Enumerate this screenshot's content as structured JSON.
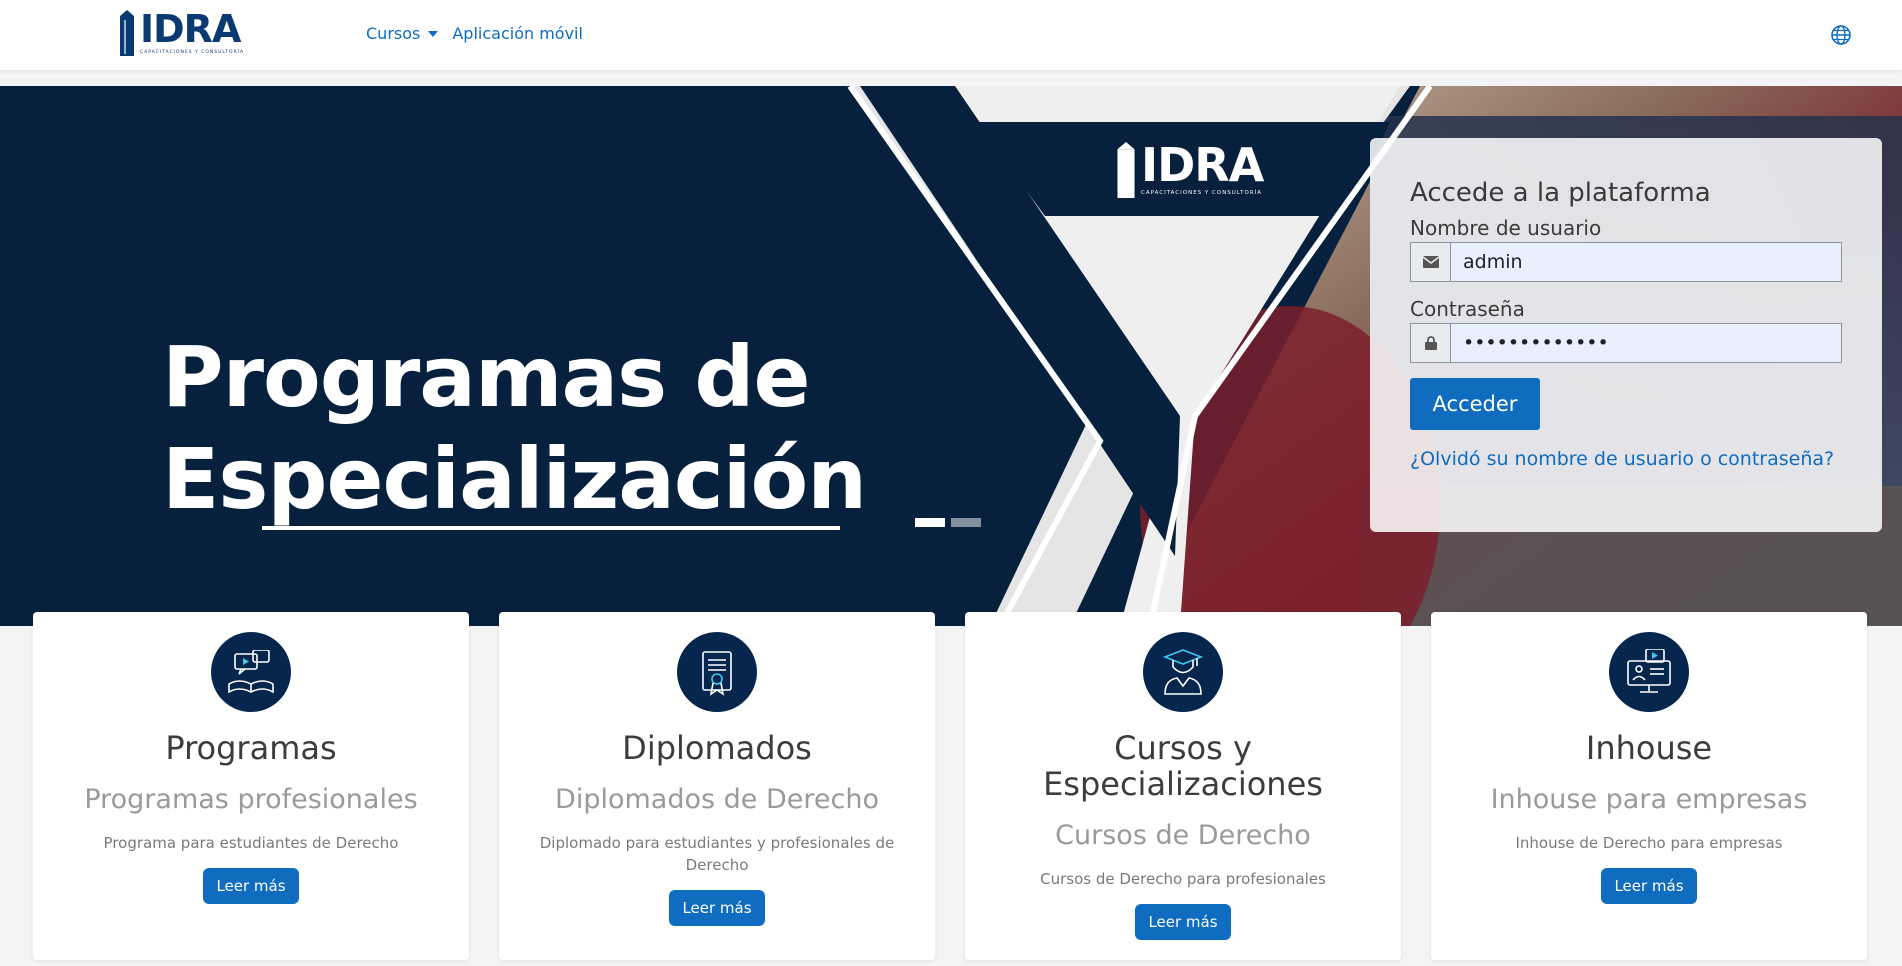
{
  "brand": {
    "name": "IDRA",
    "tagline": "CAPACITACIONES Y CONSULTORÍA",
    "color": "#0b3a73"
  },
  "nav": {
    "items": [
      {
        "label": "Cursos",
        "dropdown": true
      },
      {
        "label": "Aplicación móvil",
        "dropdown": false
      }
    ],
    "language_icon": "globe-icon",
    "link_color": "#0f6cbf"
  },
  "hero": {
    "title_line1": "Programas de",
    "title_line2": "Especialización",
    "slides": 2,
    "active_slide": 1,
    "background": "#06203d"
  },
  "login": {
    "title": "Accede a la plataforma",
    "username_label": "Nombre de usuario",
    "username_value": "admin",
    "username_icon": "envelope-icon",
    "password_label": "Contraseña",
    "password_value": "•••••••••••••",
    "password_icon": "lock-icon",
    "submit_label": "Acceder",
    "forgot_label": "¿Olvidó su nombre de usuario o contraseña?"
  },
  "cards": [
    {
      "icon": "video-book-icon",
      "title": "Programas",
      "subtitle": "Programas profesionales",
      "description": "Programa para estudiantes de Derecho",
      "button": "Leer más"
    },
    {
      "icon": "certificate-icon",
      "title": "Diplomados",
      "subtitle": "Diplomados de Derecho",
      "description": "Diplomado para estudiantes y profesionales de Derecho",
      "button": "Leer más"
    },
    {
      "icon": "graduate-icon",
      "title": "Cursos y Especializaciones",
      "subtitle": "Cursos de Derecho",
      "description": "Cursos de Derecho para profesionales",
      "button": "Leer más"
    },
    {
      "icon": "online-class-icon",
      "title": "Inhouse",
      "subtitle": "Inhouse para empresas",
      "description": "Inhouse de Derecho para empresas",
      "button": "Leer más"
    }
  ],
  "colors": {
    "primary": "#0f6cbf",
    "navy": "#06203d",
    "icon_bg": "#06264d"
  }
}
